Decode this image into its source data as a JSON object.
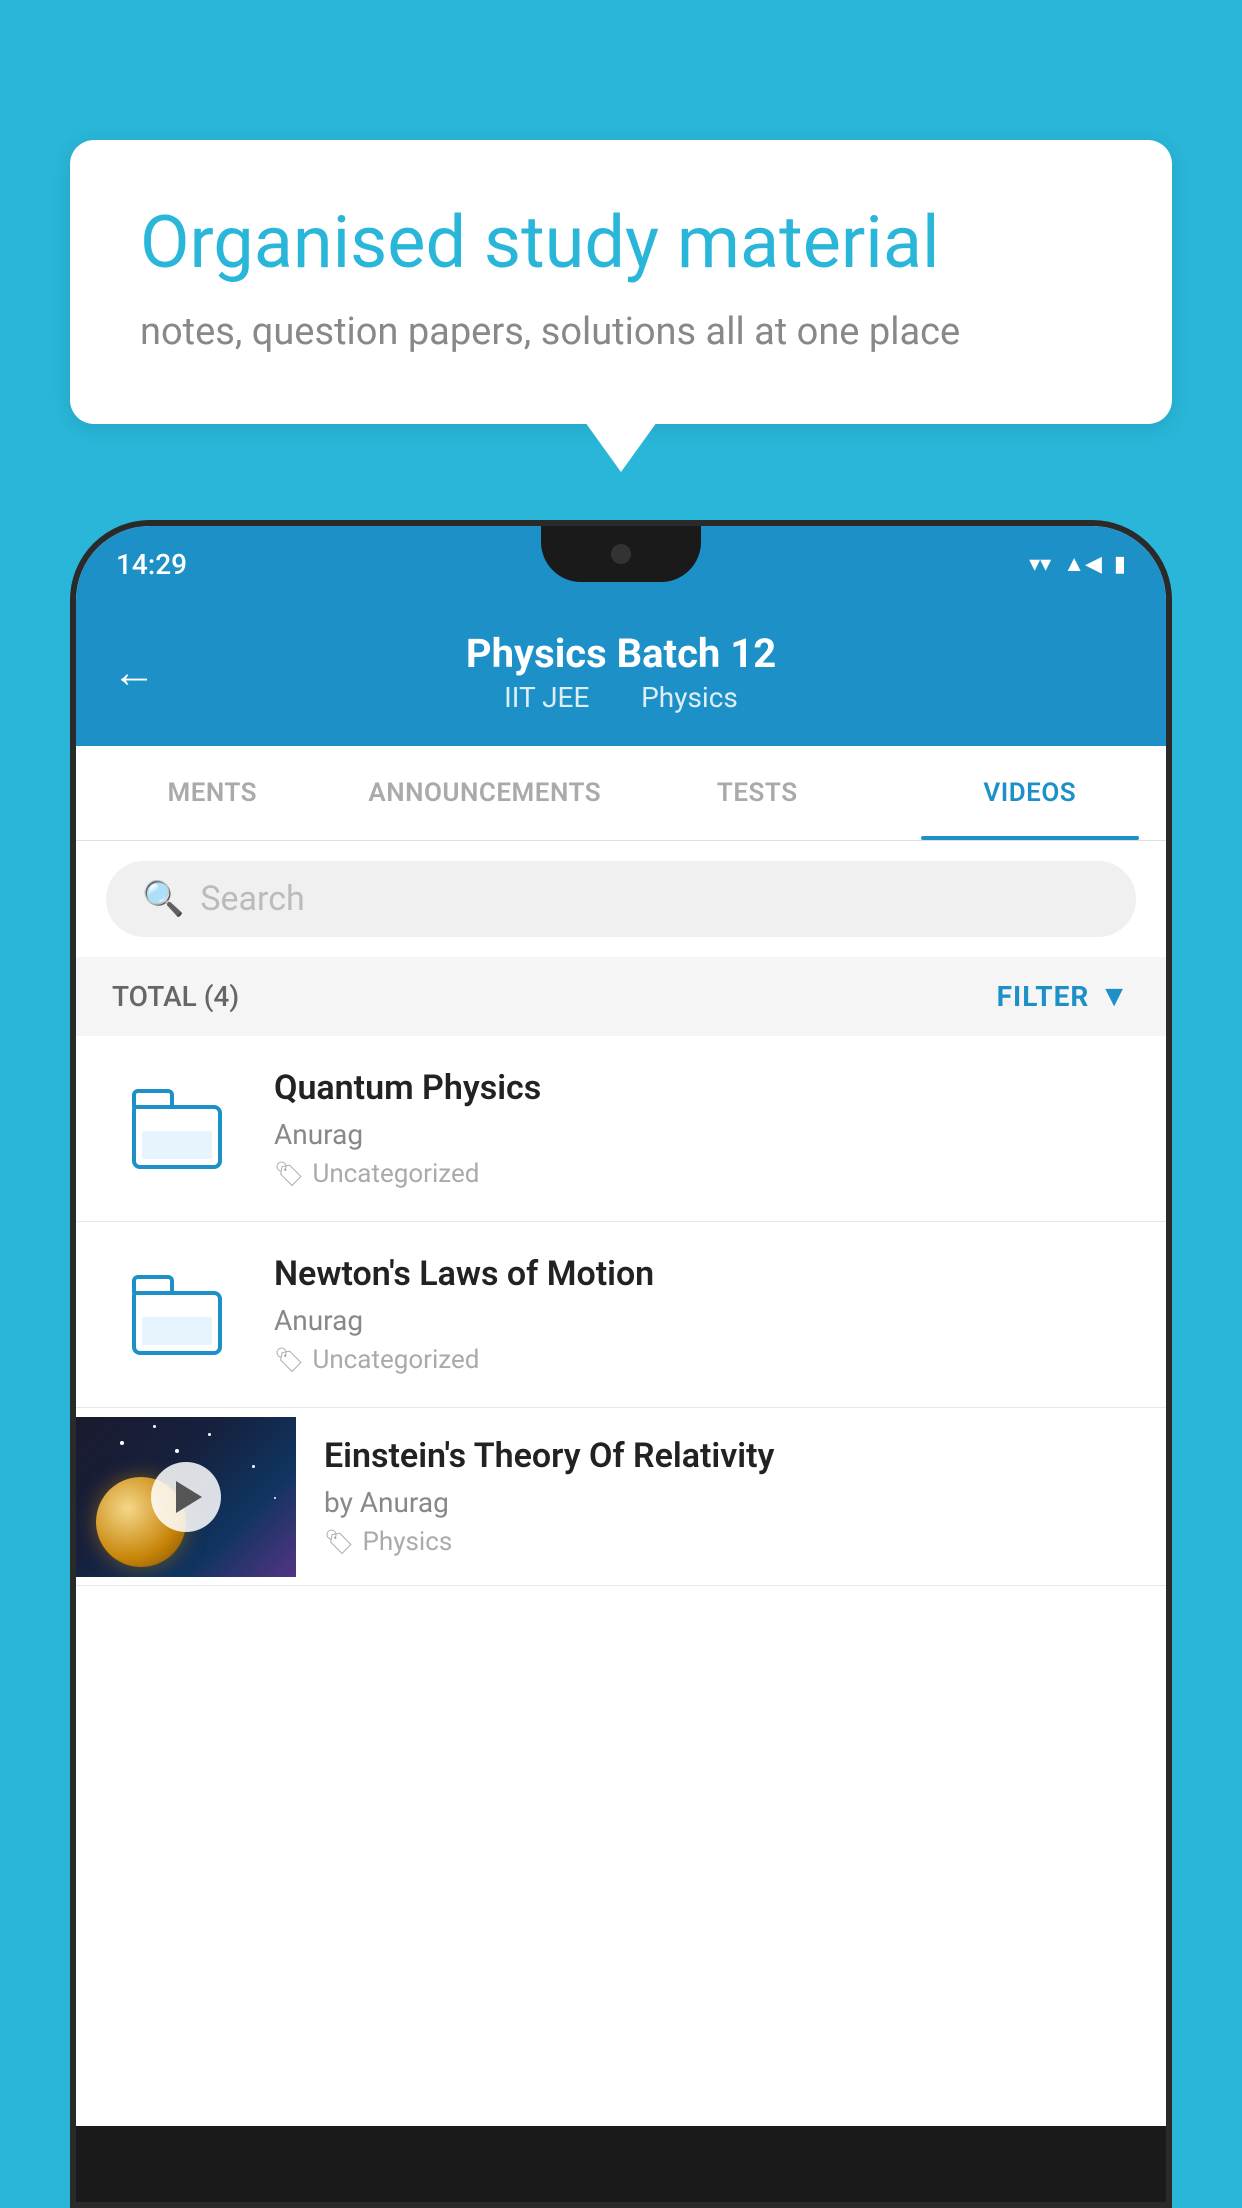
{
  "background_color": "#29b6d8",
  "speech_bubble": {
    "title": "Organised study material",
    "subtitle": "notes, question papers, solutions all at one place"
  },
  "status_bar": {
    "time": "14:29",
    "wifi_icon": "▼",
    "signal_icon": "▲",
    "battery_icon": "▮"
  },
  "app_header": {
    "back_label": "←",
    "title": "Physics Batch 12",
    "subtitle_left": "IIT JEE",
    "subtitle_right": "Physics"
  },
  "tabs": [
    {
      "label": "MENTS",
      "active": false
    },
    {
      "label": "ANNOUNCEMENTS",
      "active": false
    },
    {
      "label": "TESTS",
      "active": false
    },
    {
      "label": "VIDEOS",
      "active": true
    }
  ],
  "search": {
    "placeholder": "Search"
  },
  "filter_row": {
    "total_label": "TOTAL (4)",
    "filter_label": "FILTER"
  },
  "videos": [
    {
      "title": "Quantum Physics",
      "author": "Anurag",
      "tag": "Uncategorized",
      "has_thumb": false
    },
    {
      "title": "Newton's Laws of Motion",
      "author": "Anurag",
      "tag": "Uncategorized",
      "has_thumb": false
    },
    {
      "title": "Einstein's Theory Of Relativity",
      "author": "by Anurag",
      "tag": "Physics",
      "has_thumb": true
    }
  ]
}
